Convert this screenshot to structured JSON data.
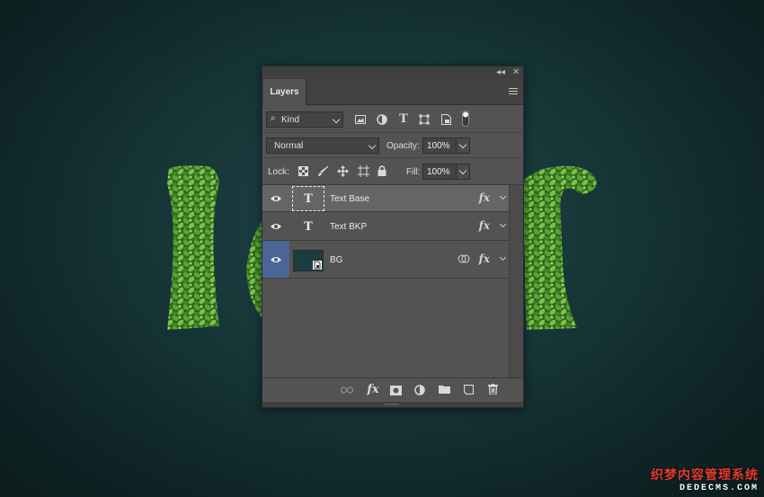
{
  "panel": {
    "title_buttons": {
      "collapse_icon": "double-chevron-left",
      "close_icon": "close-x"
    },
    "tab_label": "Layers",
    "menu_icon": "panel-menu",
    "filter": {
      "kind_label": "Kind",
      "icons": [
        "image-filter-icon",
        "adjustment-filter-icon",
        "type-filter-icon",
        "shape-filter-icon",
        "smart-object-filter-icon",
        "filter-toggle-icon"
      ]
    },
    "blend": {
      "mode": "Normal",
      "opacity_label": "Opacity:",
      "opacity_value": "100%"
    },
    "lock": {
      "label": "Lock:",
      "icons": [
        "lock-transparent-icon",
        "lock-paint-icon",
        "lock-position-icon",
        "lock-artboard-icon",
        "lock-all-icon"
      ],
      "fill_label": "Fill:",
      "fill_value": "100%"
    },
    "layers": [
      {
        "name": "Text Base",
        "type": "text",
        "selected": true,
        "visible": true,
        "fx": "fx"
      },
      {
        "name": "Text BKP",
        "type": "text",
        "selected": false,
        "visible": true,
        "fx": "fx"
      },
      {
        "name": "BG",
        "type": "smart-object",
        "selected": false,
        "visible": true,
        "fx": "fx",
        "color": "#1c3d40"
      }
    ],
    "footer_icons": [
      "link-icon",
      "fx-icon",
      "mask-icon",
      "adjustment-icon",
      "group-icon",
      "new-layer-icon",
      "trash-icon"
    ]
  },
  "watermark": {
    "line1": "织梦内容管理系统",
    "line2": "DEDECMS.COM"
  },
  "colors": {
    "background": "#163638",
    "panel": "#535353",
    "selected_layer": "#656565",
    "eye_active": "#4a6596",
    "leaf": "#3f7f2a"
  }
}
